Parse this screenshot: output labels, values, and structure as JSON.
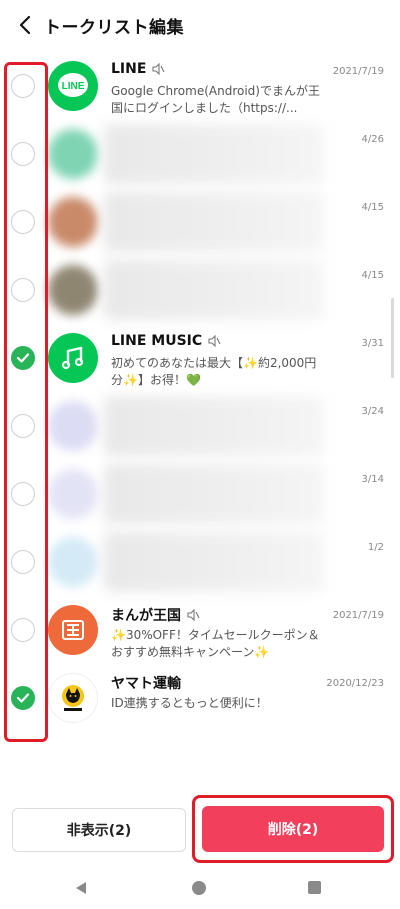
{
  "header": {
    "title": "トークリスト編集"
  },
  "chats": [
    {
      "name": "LINE",
      "muted": true,
      "message": "Google Chrome(Android)でまんが王国にログインしました（https://...",
      "date": "2021/7/19",
      "checked": false,
      "avatar": "line-logo-icon"
    },
    {
      "name": "",
      "muted": false,
      "message": "",
      "date": "4/26",
      "checked": false,
      "avatar": "blurred-avatar"
    },
    {
      "name": "",
      "muted": false,
      "message": "",
      "date": "4/15",
      "checked": false,
      "avatar": "blurred-avatar"
    },
    {
      "name": "",
      "muted": false,
      "message": "",
      "date": "4/15",
      "checked": false,
      "avatar": "blurred-avatar"
    },
    {
      "name": "LINE MUSIC",
      "muted": true,
      "message": "初めてのあなたは最大【✨約2,000円分✨】お得！💚",
      "date": "3/31",
      "checked": true,
      "avatar": "music-note-icon"
    },
    {
      "name": "",
      "muted": false,
      "message": "",
      "date": "3/24",
      "checked": false,
      "avatar": "blurred-avatar"
    },
    {
      "name": "",
      "muted": false,
      "message": "",
      "date": "3/14",
      "checked": false,
      "avatar": "blurred-avatar"
    },
    {
      "name": "",
      "muted": false,
      "message": "",
      "date": "1/2",
      "checked": false,
      "avatar": "blurred-avatar"
    },
    {
      "name": "まんが王国",
      "muted": true,
      "message": "✨30%OFF！タイムセールクーポン＆おすすめ無料キャンペーン✨",
      "date": "2021/7/19",
      "checked": false,
      "avatar": "manga-oukoku-logo-icon"
    },
    {
      "name": "ヤマト運輸",
      "muted": false,
      "message": "ID連携するともっと便利に！",
      "date": "2020/12/23",
      "checked": true,
      "avatar": "yamato-cat-logo-icon"
    }
  ],
  "footer": {
    "hide_label": "非表示(2)",
    "delete_label": "削除(2)"
  },
  "colors": {
    "accent_green": "#2ab45a",
    "delete_red": "#f23f5c",
    "highlight_red": "#e01b2a",
    "line_green": "#06c755",
    "manga_orange": "#ee6a3a"
  }
}
